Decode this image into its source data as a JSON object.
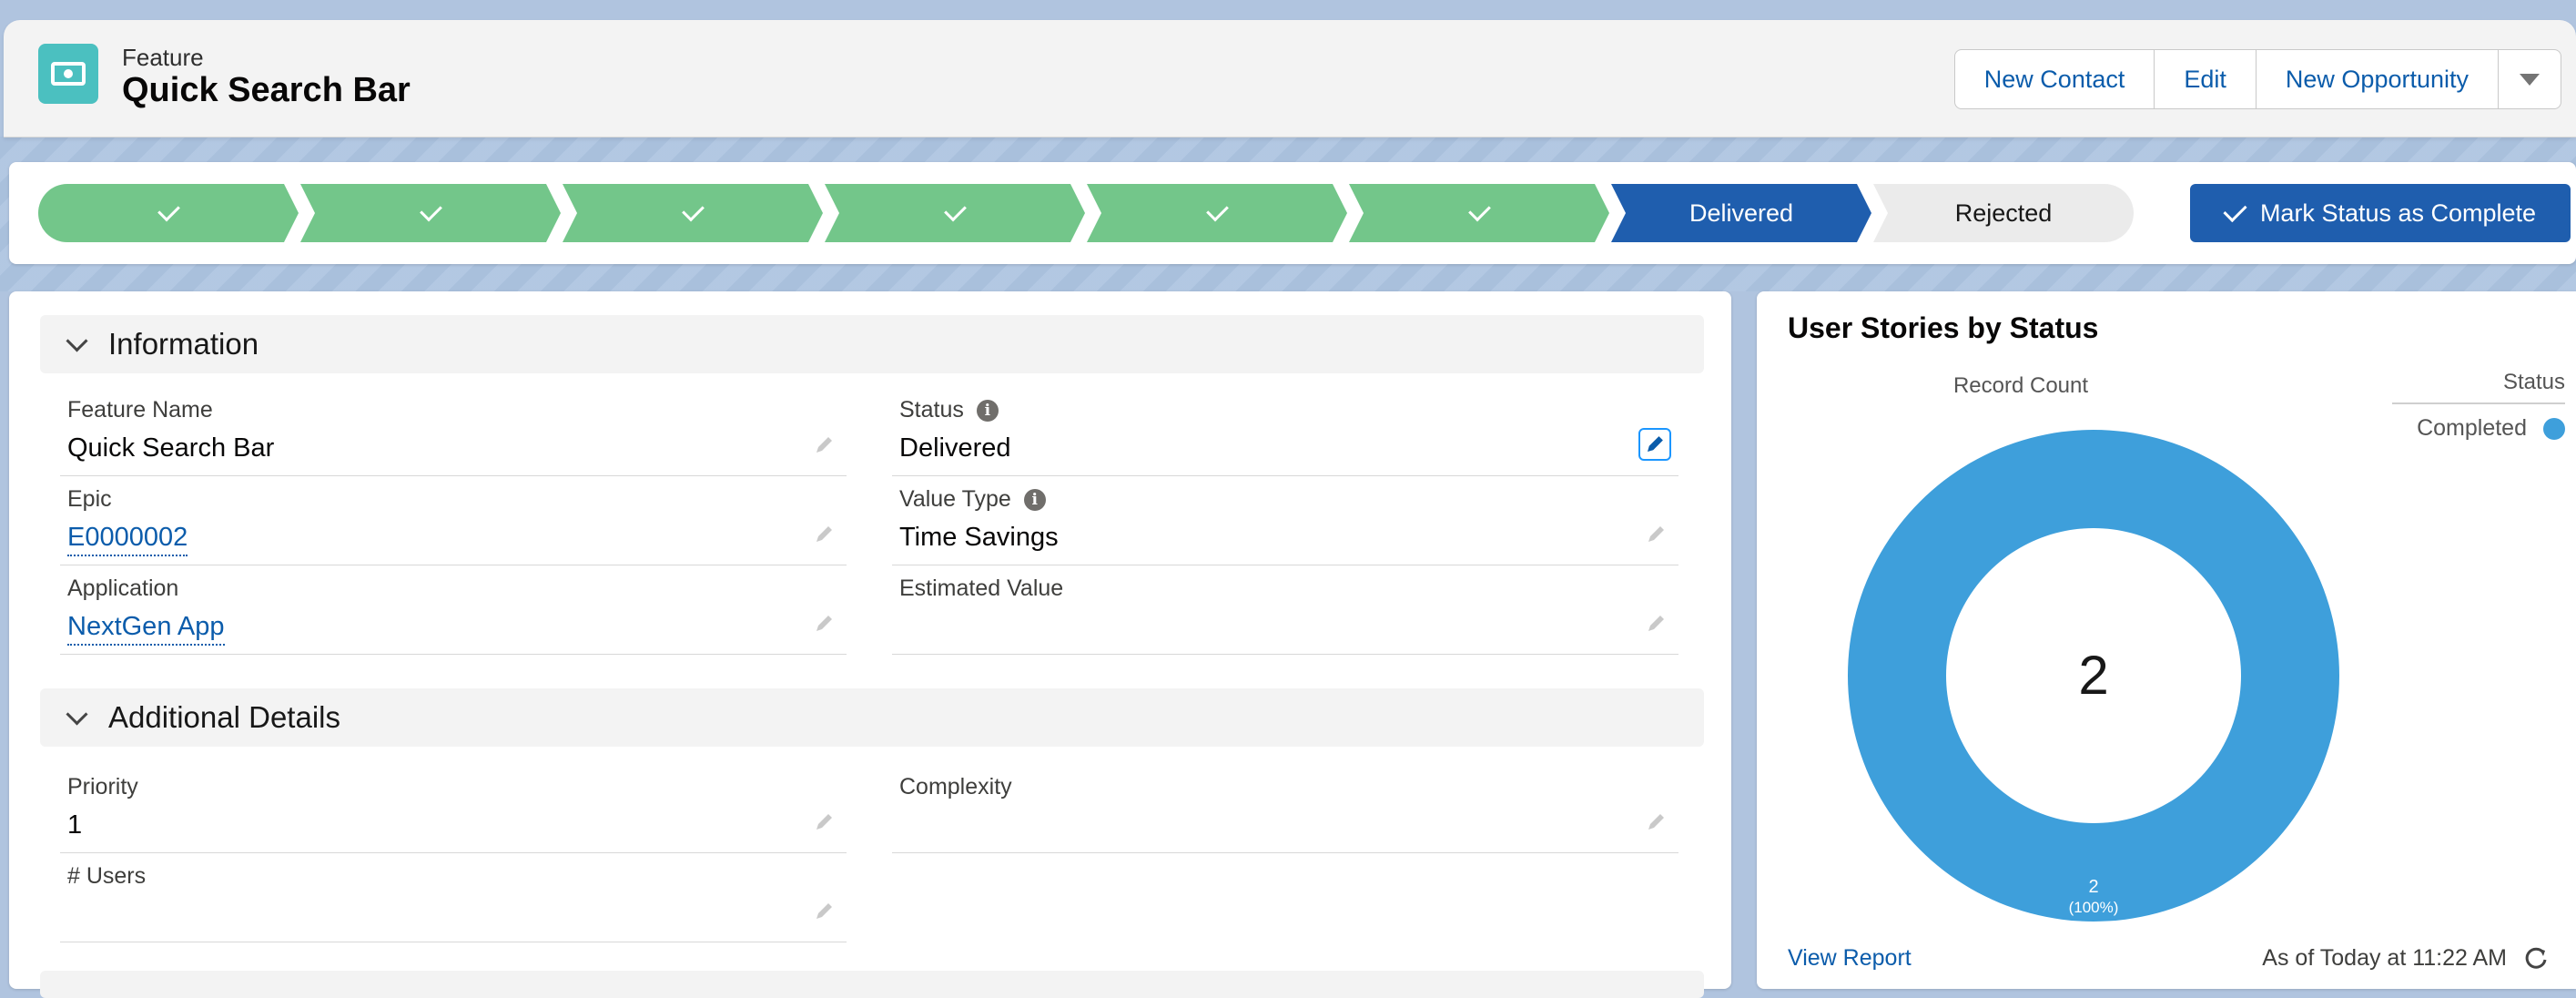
{
  "header": {
    "object_type": "Feature",
    "title": "Quick Search Bar",
    "icon": "feature-icon",
    "actions": [
      "New Contact",
      "Edit",
      "New Opportunity"
    ]
  },
  "path": {
    "completed_steps": 6,
    "current": "Delivered",
    "next": "Rejected",
    "mark_button": "Mark Status as Complete"
  },
  "information": {
    "title": "Information",
    "feature_name_label": "Feature Name",
    "feature_name": "Quick Search Bar",
    "status_label": "Status",
    "status": "Delivered",
    "epic_label": "Epic",
    "epic": "E0000002",
    "value_type_label": "Value Type",
    "value_type": "Time Savings",
    "application_label": "Application",
    "application": "NextGen App",
    "estimated_value_label": "Estimated Value",
    "estimated_value": ""
  },
  "additional": {
    "title": "Additional Details",
    "priority_label": "Priority",
    "priority": "1",
    "complexity_label": "Complexity",
    "complexity": "",
    "users_label": "# Users",
    "users": ""
  },
  "chart": {
    "title": "User Stories by Status",
    "subtitle": "Record Count",
    "legend_title": "Status",
    "legend_item": "Completed",
    "total": "2",
    "slice_label": "2",
    "slice_pct": "(100%)",
    "view_report": "View Report",
    "as_of": "As of Today at 11:22 AM",
    "color": "#3e9fdb"
  },
  "chart_data": {
    "type": "pie",
    "title": "User Stories by Status",
    "categories": [
      "Completed"
    ],
    "values": [
      2
    ],
    "legend": "top-right"
  }
}
